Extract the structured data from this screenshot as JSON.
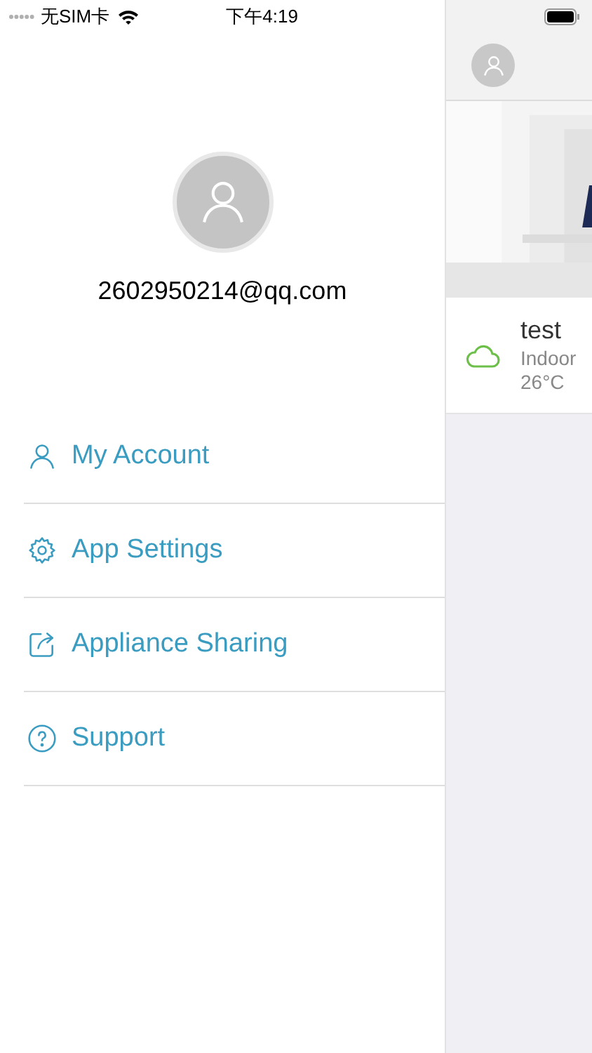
{
  "status_bar": {
    "carrier": "无SIM卡",
    "time": "下午4:19"
  },
  "drawer": {
    "email": "2602950214@qq.com",
    "menu": [
      {
        "kind": "account",
        "label": "My Account"
      },
      {
        "kind": "settings",
        "label": "App Settings"
      },
      {
        "kind": "sharing",
        "label": "Appliance Sharing"
      },
      {
        "kind": "support",
        "label": "Support"
      }
    ]
  },
  "main": {
    "device": {
      "name": "test",
      "location": "Indoor",
      "temperature": "26°C"
    }
  }
}
